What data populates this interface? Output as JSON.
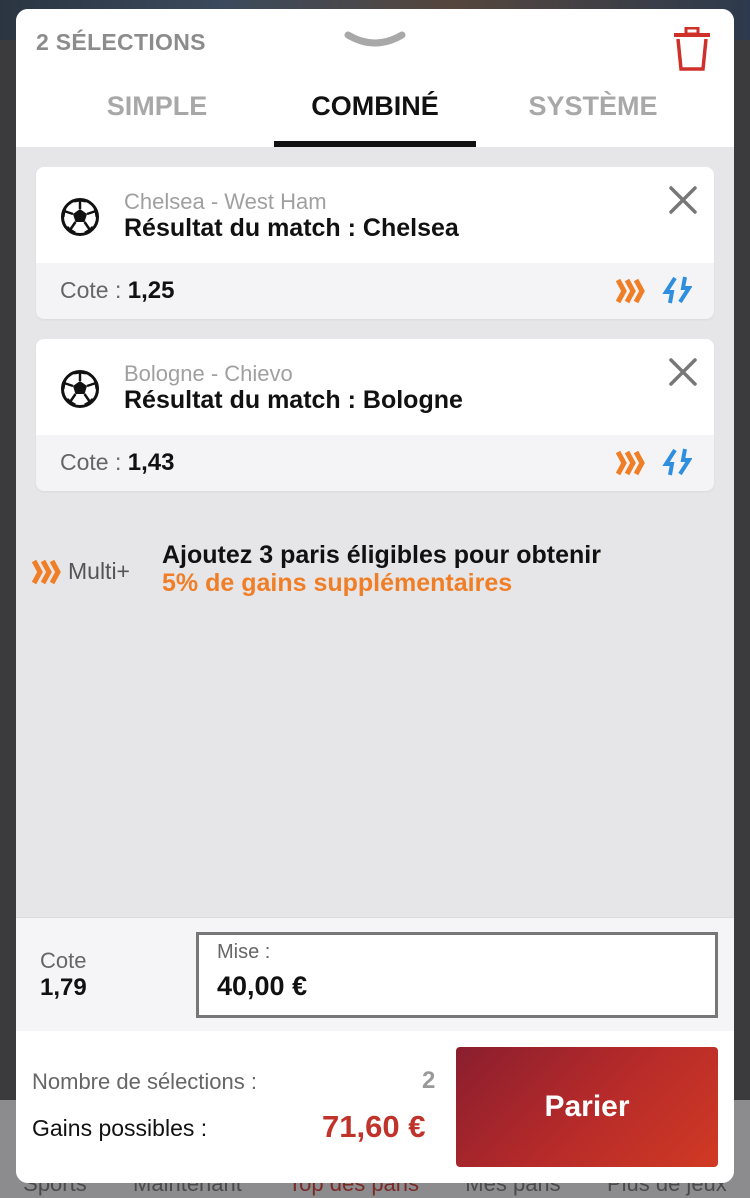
{
  "background_nav": {
    "items": [
      "Sports",
      "Maintenant",
      "Top des paris",
      "Mes paris",
      "Plus de jeux"
    ],
    "active_index": 2
  },
  "header": {
    "selections_count_label": "2 SÉLECTIONS",
    "tabs": [
      {
        "label": "SIMPLE",
        "active": false
      },
      {
        "label": "COMBINÉ",
        "active": true
      },
      {
        "label": "SYSTÈME",
        "active": false
      }
    ]
  },
  "bets": [
    {
      "sport_icon": "soccer-ball-icon",
      "match": "Chelsea - West Ham",
      "market": "Résultat du match : Chelsea",
      "odds_label": "Cote :",
      "odds": "1,25"
    },
    {
      "sport_icon": "soccer-ball-icon",
      "match": "Bologne - Chievo",
      "market": "Résultat du match : Bologne",
      "odds_label": "Cote :",
      "odds": "1,43"
    }
  ],
  "promo": {
    "badge_label": "Multi+",
    "line1": "Ajoutez 3 paris éligibles pour obtenir",
    "line2": "5% de gains supplémentaires"
  },
  "stake": {
    "total_odds_label": "Cote",
    "total_odds": "1,79",
    "stake_label": "Mise :",
    "stake_value": "40,00 €"
  },
  "summary": {
    "selections_label": "Nombre de sélections :",
    "selections_value": "2",
    "gains_label": "Gains possibles :",
    "gains_value": "71,60 €",
    "bet_button_label": "Parier"
  },
  "colors": {
    "accent_orange": "#f07e26",
    "accent_blue": "#2e8fe0",
    "trash_red": "#d0302a",
    "gains_red": "#c0332a"
  }
}
